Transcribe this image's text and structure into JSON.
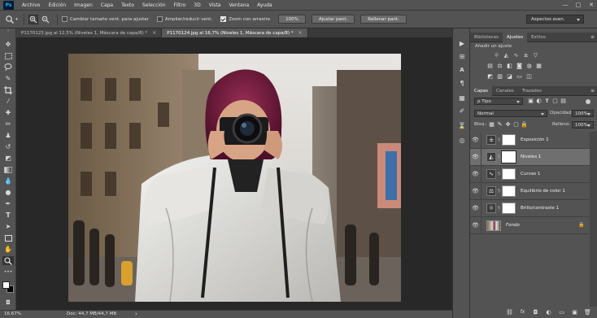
{
  "app": {
    "logo": "Ps"
  },
  "menu": [
    "Archivo",
    "Edición",
    "Imagen",
    "Capa",
    "Texto",
    "Selección",
    "Filtro",
    "3D",
    "Vista",
    "Ventana",
    "Ayuda"
  ],
  "window_controls": {
    "minimize": "—",
    "maximize": "□",
    "close": "✕"
  },
  "options_bar": {
    "tool_icon": "zoom-tool-icon",
    "cb_resize": {
      "label": "Cambiar tamaño vent. para ajustar",
      "checked": false
    },
    "cb_zoom_all": {
      "label": "Ampliar/reducir vent.",
      "checked": false
    },
    "cb_scrubby": {
      "label": "Zoom con arrastre",
      "checked": true
    },
    "btn_100": "100%",
    "btn_fit": "Ajustar pant.",
    "btn_fill": "Rellenar pant.",
    "workspace": "Aspectos esen."
  },
  "doc_tabs": [
    {
      "label": "P1170123.jpg al 12,5% (Niveles 1, Máscara de capa/8) *",
      "close": "×",
      "active": false
    },
    {
      "label": "P1170124.jpg al 16,7% (Niveles 1, Máscara de capa/8) *",
      "close": "×",
      "active": true
    }
  ],
  "status": {
    "zoom": "16,67%",
    "doc": "Doc: 44,7 MB/44,7 MB",
    "arrow": "›"
  },
  "adjustments_panel": {
    "tabs": [
      "Bibliotecas",
      "Ajustes",
      "Estilos"
    ],
    "active_tab": "Ajustes",
    "title": "Añadir un ajuste",
    "menu_icon": "≡"
  },
  "layers_panel": {
    "tabs": [
      "Capas",
      "Canales",
      "Trazados"
    ],
    "active_tab": "Capas",
    "filter_kind": "ρ Tipo",
    "blend_mode": "Normal",
    "opacity_label": "Opacidad:",
    "opacity_value": "100%",
    "lock_label": "Bloq.:",
    "fill_label": "Relleno:",
    "fill_value": "100%",
    "layers": [
      {
        "name": "Exposición 1",
        "icon": "exposure-icon",
        "glyph": "±",
        "selected": false
      },
      {
        "name": "Niveles 1",
        "icon": "levels-icon",
        "glyph": "◭",
        "selected": true
      },
      {
        "name": "Curvas 1",
        "icon": "curves-icon",
        "glyph": "∿",
        "selected": false
      },
      {
        "name": "Equilibrio de color 1",
        "icon": "color-balance-icon",
        "glyph": "⚖",
        "selected": false
      },
      {
        "name": "Brillo/contraste 1",
        "icon": "brightness-contrast-icon",
        "glyph": "☼",
        "selected": false
      },
      {
        "name": "Fondo",
        "icon": "background-thumbnail",
        "glyph": "",
        "selected": false,
        "locked": true
      }
    ]
  },
  "colors": {
    "ui_bg": "#535353",
    "canvas_bg": "#282828",
    "ps_blue": "#31a8ff",
    "selected_row": "#6f6f6f"
  }
}
